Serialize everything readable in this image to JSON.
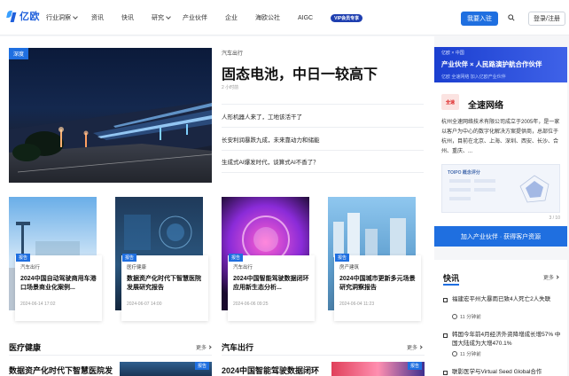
{
  "header": {
    "logo_text": "亿欧",
    "nav": [
      {
        "label": "行业洞察",
        "dropdown": true
      },
      {
        "label": "资讯",
        "dropdown": false
      },
      {
        "label": "快讯",
        "dropdown": false
      },
      {
        "label": "研究",
        "dropdown": true
      },
      {
        "label": "产业伙伴",
        "dropdown": false
      },
      {
        "label": "企业",
        "dropdown": false
      },
      {
        "label": "海欧公社",
        "dropdown": false
      },
      {
        "label": "AIGC",
        "dropdown": false
      }
    ],
    "vip_label": "VIP会员专享",
    "join_label": "我要入驻",
    "login_label": "登录/注册"
  },
  "hero": {
    "tag": "深度",
    "category": "汽车出行",
    "title": "固态电池，中日一较高下",
    "time": "2 小时前"
  },
  "headlines": [
    "人形机器人来了，工地该活干了",
    "长安利润暴跌九成，未来靠动力和储能",
    "生成式AI爆发时代，谈算式AI不香了？"
  ],
  "cards": [
    {
      "badge": "报告",
      "category": "汽车出行",
      "title": "2024中国自动驾驶商用车港口场景商业化案例...",
      "time": "2024-06-14 17:02"
    },
    {
      "badge": "报告",
      "category": "医疗健康",
      "title": "数据资产化时代下智慧医院发展研究报告",
      "time": "2024-06-07 14:00"
    },
    {
      "badge": "报告",
      "category": "汽车出行",
      "title": "2024中国智能驾驶数据闭环应用新生态分析...",
      "time": "2024-06-06 09:25"
    },
    {
      "badge": "报告",
      "category": "房产建筑",
      "title": "2024中国城市更新多元场景研究洞察报告",
      "time": "2024-06-04 11:23"
    }
  ],
  "sections": [
    {
      "title": "医疗健康",
      "more": "更多",
      "item_title": "数据资产化时代下智慧医院发",
      "badge": "报告"
    },
    {
      "title": "汽车出行",
      "more": "更多",
      "item_title": "2024中国智能驾驶数据闭环",
      "badge": "报告"
    }
  ],
  "partner": {
    "banner_small": "亿欧 × 中国",
    "banner_main": "产业伙伴 × 人民路演护航合作伙伴",
    "banner_sub": "亿欧 全速网络 加入亿欧产业伙伴",
    "logo_text": "全速",
    "company_name": "全速网络",
    "description": "杭州全速网络技术有限公司成立于2005年，是一家以客户为中心的数字化解决方案提供商，总部位于杭州，目前在北京、上海、深圳、西安、长沙、合州、重庆、...",
    "chart_label": "TOIPO 概念评分",
    "pager": "3 / 10",
    "button_label": "加入产业伙伴 · 获得客户资源"
  },
  "flash": {
    "title": "快讯",
    "more": "更多",
    "items": [
      {
        "text": "福建宏平州大暴雨已致4人死亡2人失联",
        "time": "11 分钟前"
      },
      {
        "text": "韩国今年前4月经济外资降增成长增57% 中国大陆成为大增470.1%",
        "time": "11 分钟前"
      },
      {
        "text": "联影医学与Virtual Seed Global合作",
        "time": ""
      }
    ]
  }
}
